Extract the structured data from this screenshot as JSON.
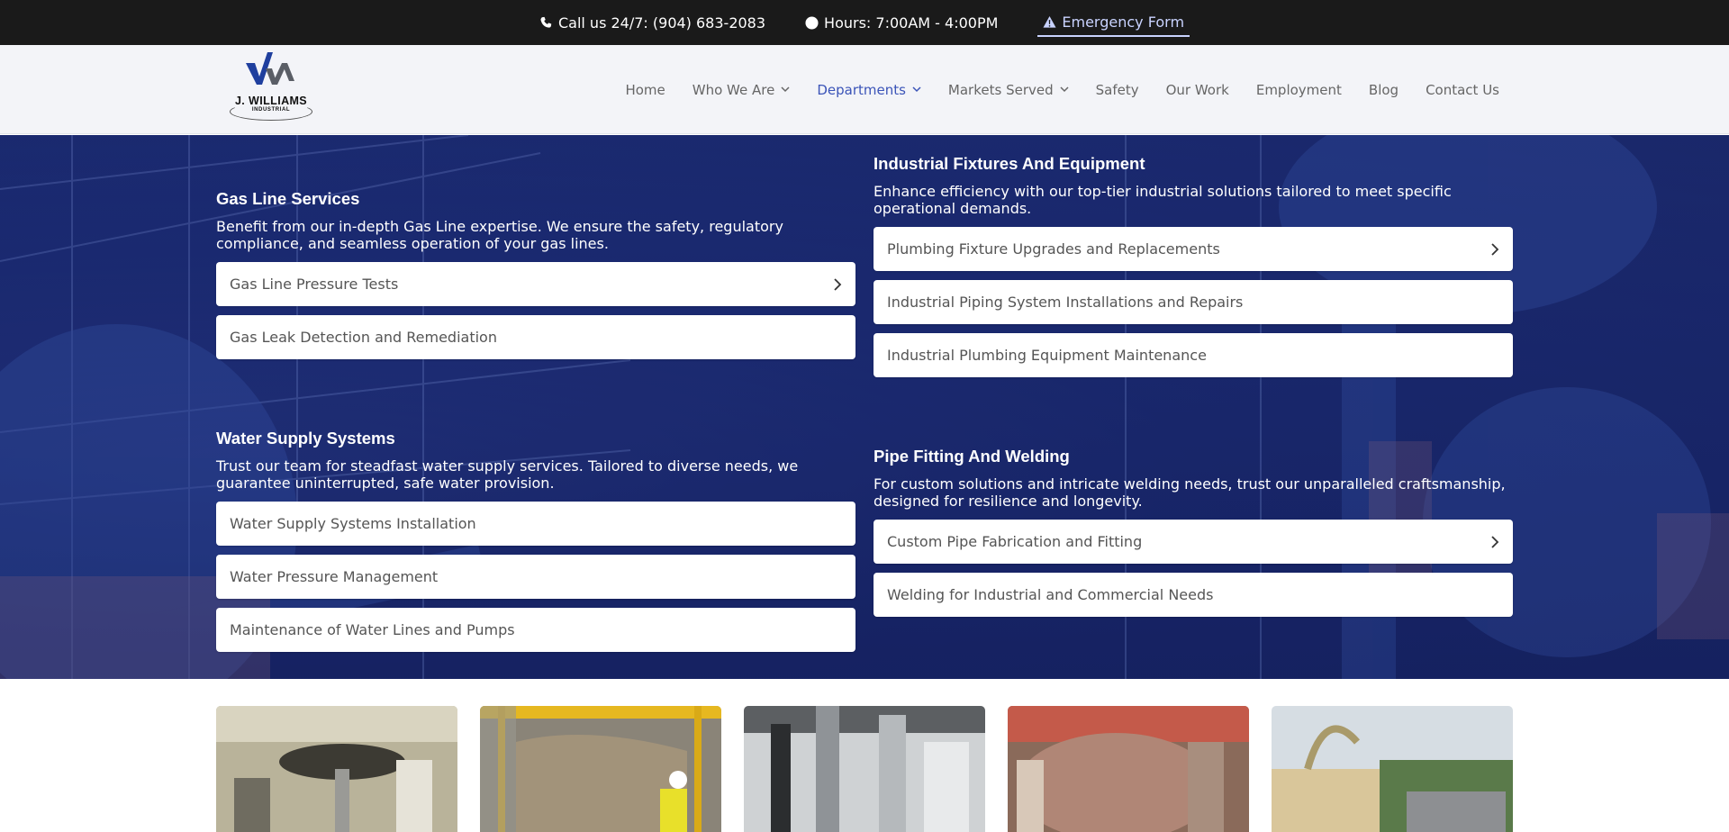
{
  "topbar": {
    "phone": "Call us 24/7: (904) 683-2083",
    "hours": "Hours: 7:00AM - 4:00PM",
    "emergency": "Emergency Form"
  },
  "logo": {
    "line1": "J. WILLIAMS",
    "line2": "INDUSTRIAL"
  },
  "nav": [
    {
      "label": "Home",
      "dropdown": false
    },
    {
      "label": "Who We Are",
      "dropdown": true
    },
    {
      "label": "Departments",
      "dropdown": true,
      "active": true
    },
    {
      "label": "Markets Served",
      "dropdown": true
    },
    {
      "label": "Safety",
      "dropdown": false
    },
    {
      "label": "Our Work",
      "dropdown": false
    },
    {
      "label": "Employment",
      "dropdown": false
    },
    {
      "label": "Blog",
      "dropdown": false
    },
    {
      "label": "Contact Us",
      "dropdown": false
    }
  ],
  "categories": [
    {
      "title": "Gas Line Services",
      "description": "Benefit from our in-depth Gas Line expertise. We ensure the safety, regulatory compliance, and seamless operation of your gas lines.",
      "items": [
        "Gas Line Pressure Tests",
        "Gas Leak Detection and Remediation"
      ]
    },
    {
      "title": "Industrial Fixtures And Equipment",
      "description": "Enhance efficiency with our top-tier industrial solutions tailored to meet specific operational demands.",
      "items": [
        "Plumbing Fixture Upgrades and Replacements",
        "Industrial Piping System Installations and Repairs",
        "Industrial Plumbing Equipment Maintenance"
      ]
    },
    {
      "title": "Water Supply Systems",
      "description": "Trust our team for steadfast water supply services. Tailored to diverse needs, we guarantee uninterrupted, safe water provision.",
      "items": [
        "Water Supply Systems Installation",
        "Water Pressure Management",
        "Maintenance of Water Lines and Pumps"
      ]
    },
    {
      "title": "Pipe Fitting And Welding",
      "description": "For custom solutions and intricate welding needs, trust our unparalleled craftsmanship, designed for resilience and longevity.",
      "items": [
        "Custom Pipe Fabrication and Fitting",
        "Welding for Industrial and Commercial Needs"
      ]
    }
  ],
  "colors": {
    "topbar_bg": "#1a1a1a",
    "header_bg": "#f3f4f8",
    "accent": "#3b54b8",
    "hero_overlay": "#1b2a6e",
    "emergency_link": "#c9d3ff"
  },
  "icons": [
    "phone-icon",
    "clock-icon",
    "warning-icon",
    "chevron-down-icon",
    "chevron-right-icon"
  ]
}
